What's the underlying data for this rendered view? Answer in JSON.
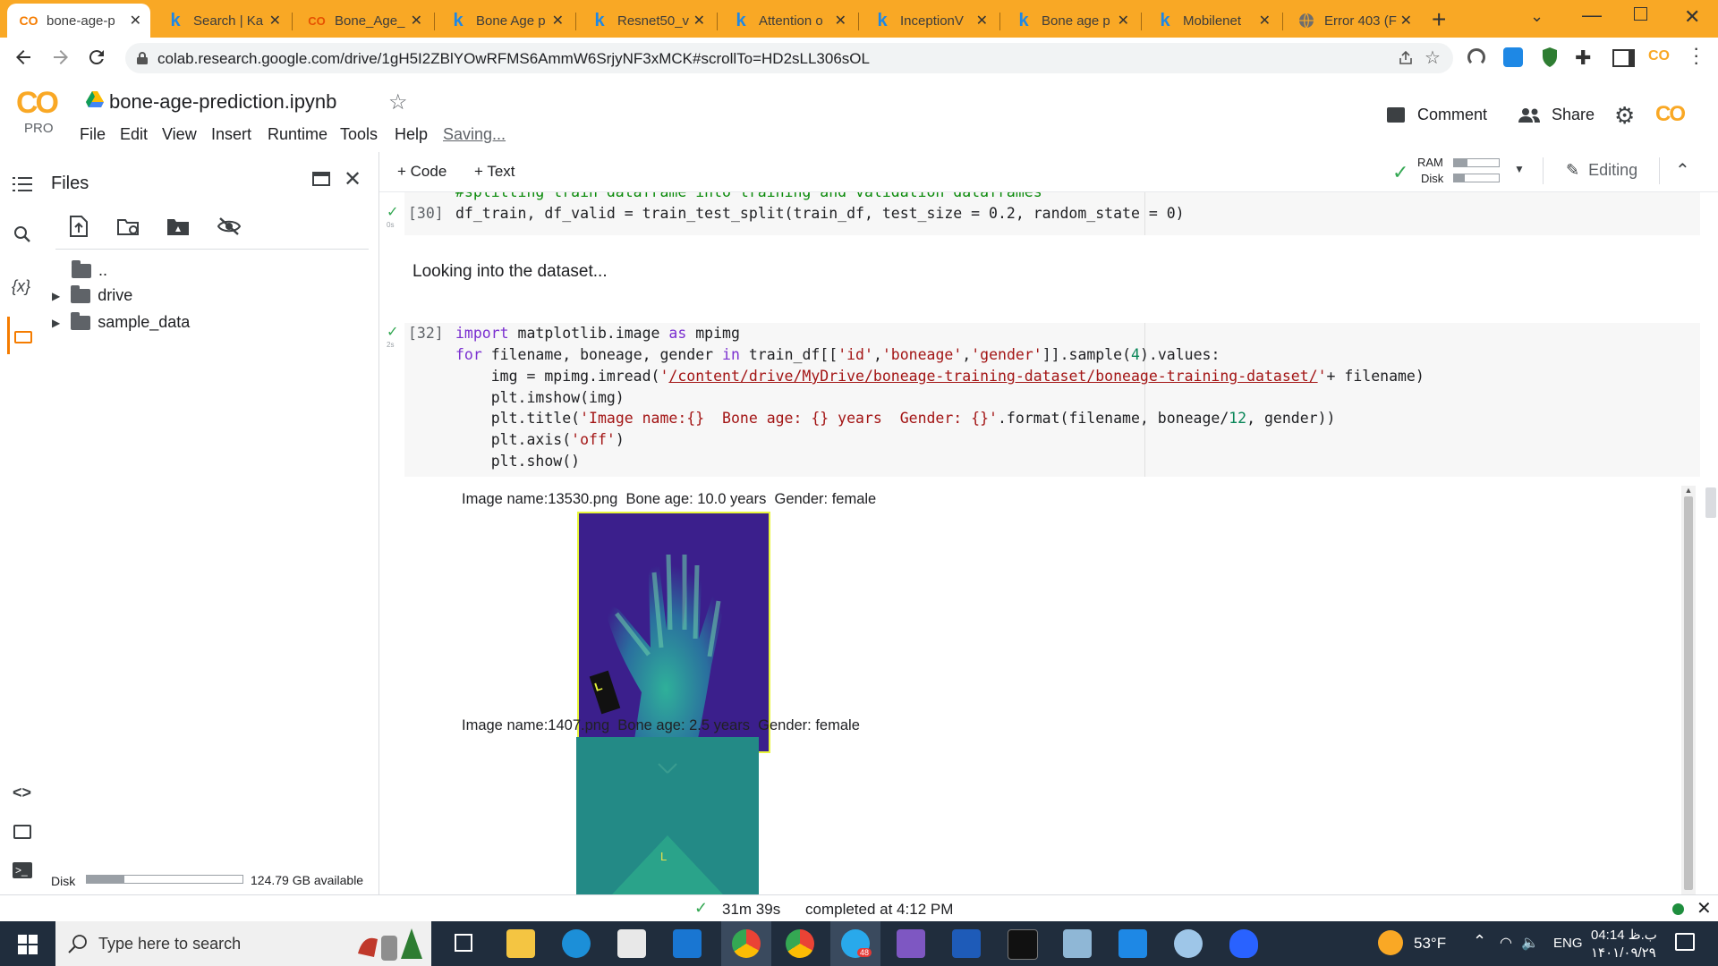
{
  "browser": {
    "tabs": [
      {
        "title": "bone-age-p",
        "favicon": "colab-icon",
        "active": true
      },
      {
        "title": "Search | Ka",
        "favicon": "kaggle-icon"
      },
      {
        "title": "Bone_Age_",
        "favicon": "colab-icon"
      },
      {
        "title": "Bone Age p",
        "favicon": "kaggle-icon"
      },
      {
        "title": "Resnet50_v",
        "favicon": "kaggle-icon"
      },
      {
        "title": "Attention o",
        "favicon": "kaggle-icon"
      },
      {
        "title": "InceptionV",
        "favicon": "kaggle-icon"
      },
      {
        "title": "Bone age p",
        "favicon": "kaggle-icon"
      },
      {
        "title": "Mobilenet",
        "favicon": "kaggle-icon"
      },
      {
        "title": "Error 403 (F",
        "favicon": "globe-icon"
      }
    ],
    "url": "colab.research.google.com/drive/1gH5I2ZBlYOwRFMS6AmmW6SrjyNF3xMCK#scrollTo=HD2sLL306sOL",
    "accent": "#f9a825"
  },
  "colab": {
    "logo": "CO",
    "pro": "PRO",
    "notebook_title": "bone-age-prediction.ipynb",
    "menu": [
      "File",
      "Edit",
      "View",
      "Insert",
      "Runtime",
      "Tools",
      "Help"
    ],
    "saving": "Saving...",
    "comment": "Comment",
    "share": "Share",
    "add_code": "+ Code",
    "add_text": "+ Text",
    "ram": "RAM",
    "disk": "Disk",
    "editing": "Editing"
  },
  "sidebar": {
    "title": "Files",
    "tree": [
      {
        "label": ".."
      },
      {
        "label": "drive"
      },
      {
        "label": "sample_data"
      }
    ],
    "disk_label": "Disk",
    "disk_available": "124.79 GB available",
    "disk_used_fraction": 0.24
  },
  "cells": {
    "cell30": {
      "comment": "#splitting train dataframe into training and validation dataframes",
      "exec": "[30]",
      "time": "0s",
      "code": "df_train, df_valid = train_test_split(train_df, test_size = 0.2, random_state = 0)"
    },
    "markdown": "Looking into the dataset...",
    "cell32": {
      "exec": "[32]",
      "time": "2s",
      "lines": [
        "import matplotlib.image as mpimg",
        "for filename, boneage, gender in train_df[['id','boneage','gender']].sample(4).values:",
        "    img = mpimg.imread('/content/drive/MyDrive/boneage-training-dataset/boneage-training-dataset/'+ filename)",
        "    plt.imshow(img)",
        "    plt.title('Image name:{}  Bone age: {} years  Gender: {}'.format(filename, boneage/12, gender))",
        "    plt.axis('off')",
        "    plt.show()"
      ]
    },
    "outputs": [
      {
        "title": "Image name:13530.png  Bone age: 10.0 years  Gender: female"
      },
      {
        "title": "Image name:1407.png  Bone age: 2.5 years  Gender: female"
      }
    ]
  },
  "statusbar": {
    "elapsed": "31m 39s",
    "completed": "completed at 4:12 PM"
  },
  "taskbar": {
    "search_placeholder": "Type here to search",
    "weather": "53°F",
    "language": "ENG",
    "time": "04:14 ب.ظ",
    "date": "۱۴۰۱/۰۹/۲۹",
    "telegram_badge": "48"
  }
}
